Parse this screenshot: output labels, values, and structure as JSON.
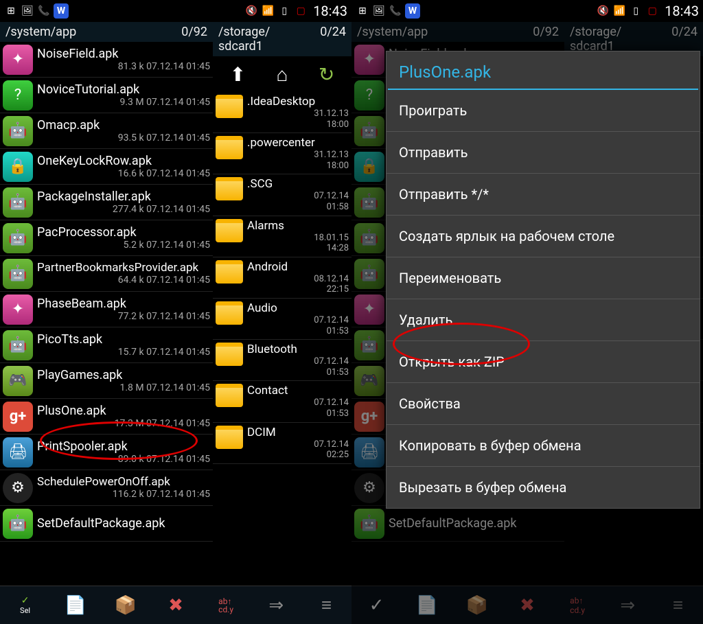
{
  "status": {
    "time": "18:43"
  },
  "left_phone": {
    "pane_left": {
      "path": "/system/app",
      "count": "0/92",
      "files": [
        {
          "name": "NoiseField.apk",
          "meta": "81.3 k   07.12.14  01:45",
          "icon": "pink"
        },
        {
          "name": "NoviceTutorial.apk",
          "meta": "9.3 M   07.12.14  01:45",
          "icon": "q"
        },
        {
          "name": "Omacp.apk",
          "meta": "93.5 k   07.12.14  01:45",
          "icon": "android"
        },
        {
          "name": "OneKeyLockRow.apk",
          "meta": "16.6 k   07.12.14  01:45",
          "icon": "lock"
        },
        {
          "name": "PackageInstaller.apk",
          "meta": "277.4 k   07.12.14  01:45",
          "icon": "android"
        },
        {
          "name": "PacProcessor.apk",
          "meta": "5.2 k   07.12.14  01:45",
          "icon": "android"
        },
        {
          "name": "PartnerBookmarksProvider.apk",
          "meta": "64.4 k   07.12.14  01:45",
          "icon": "android",
          "wrap": true
        },
        {
          "name": "PhaseBeam.apk",
          "meta": "77.2 k   07.12.14  01:45",
          "icon": "pink"
        },
        {
          "name": "PicoTts.apk",
          "meta": "15.7 k   07.12.14  01:45",
          "icon": "android"
        },
        {
          "name": "PlayGames.apk",
          "meta": "1.8 M   07.12.14  01:45",
          "icon": "game"
        },
        {
          "name": "PlusOne.apk",
          "meta": "17.3 M   07.12.14  01:45",
          "icon": "gplus",
          "highlight": true
        },
        {
          "name": "PrintSpooler.apk",
          "meta": "89.0 k   07.12.14  01:45",
          "icon": "print"
        },
        {
          "name": "SchedulePowerOnOff.apk",
          "meta": "116.2 k   07.12.14  01:45",
          "icon": "gear",
          "wrap": true
        },
        {
          "name": "SetDefaultPackage.apk",
          "meta": "",
          "icon": "greenbar"
        }
      ]
    },
    "pane_right": {
      "path": "/storage/sdcard1",
      "count": "0/24",
      "folders": [
        {
          "name": ".IdeaDesktop",
          "meta": "<dir>  31.12.13",
          "time": "18:00"
        },
        {
          "name": ".powercenter",
          "meta": "<dir>  31.12.13",
          "time": "18:00"
        },
        {
          "name": ".SCG",
          "meta": "<dir>  07.12.14",
          "time": "01:58"
        },
        {
          "name": "Alarms",
          "meta": "<dir>  18.01.15",
          "time": "14:28"
        },
        {
          "name": "Android",
          "meta": "<dir>  08.12.14",
          "time": "22:15"
        },
        {
          "name": "Audio",
          "meta": "<dir>  07.12.14",
          "time": "01:53"
        },
        {
          "name": "Bluetooth",
          "meta": "<dir>  07.12.14",
          "time": "01:53"
        },
        {
          "name": "Contact",
          "meta": "<dir>  07.12.14",
          "time": "01:53"
        },
        {
          "name": "DCIM",
          "meta": "<dir>  07.12.14",
          "time": "02:25"
        }
      ]
    }
  },
  "right_phone": {
    "pane_left": {
      "path": "/system/app",
      "count": "0/92"
    },
    "pane_right": {
      "path": "/storage/sdcard1",
      "count": "0/24"
    },
    "modal": {
      "title": "PlusOne.apk",
      "items": [
        "Проиграть",
        "Отправить",
        "Отправить */*",
        "Создать ярлык на рабочем столе",
        "Переименовать",
        "Удалить",
        "Открыть как ZIP",
        "Свойства",
        "Копировать в буфер обмена",
        "Вырезать в буфер обмена"
      ]
    }
  },
  "toolbar_labels": {
    "sel": "Sel",
    "abcd": "ab↑\ncd.y"
  }
}
